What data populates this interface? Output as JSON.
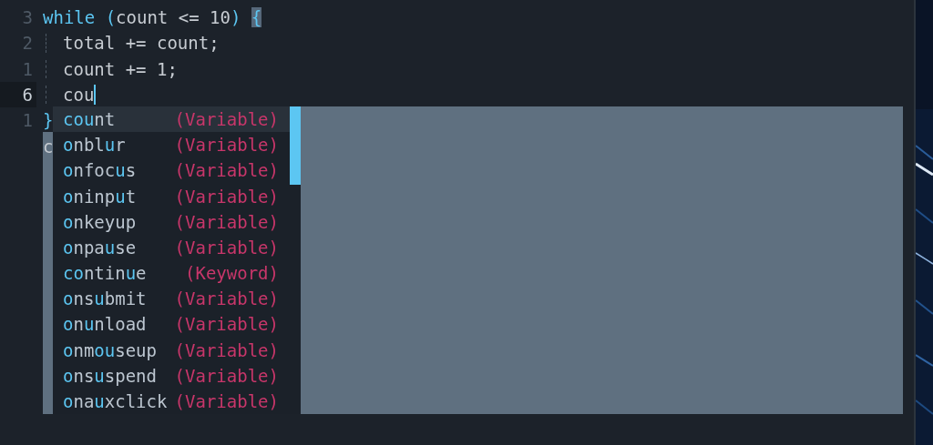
{
  "editor": {
    "lines": [
      {
        "number": "3",
        "current": false,
        "indented": false,
        "cursor": false,
        "tokens": [
          {
            "text": "while",
            "kind": "keyword"
          },
          {
            "text": " (",
            "kind": "punct"
          },
          {
            "text": "count <= 10",
            "kind": "plain"
          },
          {
            "text": ") ",
            "kind": "punct"
          },
          {
            "text": "{",
            "kind": "match"
          }
        ]
      },
      {
        "number": "2",
        "current": false,
        "indented": true,
        "cursor": false,
        "tokens": [
          {
            "text": "total += count;",
            "kind": "plain"
          }
        ]
      },
      {
        "number": "1",
        "current": false,
        "indented": true,
        "cursor": false,
        "tokens": [
          {
            "text": "count += 1;",
            "kind": "plain"
          }
        ]
      },
      {
        "number": "6",
        "current": true,
        "indented": true,
        "cursor": true,
        "tokens": [
          {
            "text": "cou",
            "kind": "plain"
          }
        ]
      },
      {
        "number": "1",
        "current": false,
        "indented": false,
        "cursor": false,
        "tokens": [
          {
            "text": "}",
            "kind": "punct"
          }
        ]
      },
      {
        "current": false,
        "indented": false,
        "cursor": false,
        "tokens": [
          {
            "text": "c",
            "kind": "plain"
          }
        ]
      }
    ]
  },
  "completion": {
    "items": [
      {
        "label": "**cou**nt",
        "kind_label": "(Variable)",
        "selected": true
      },
      {
        "label": "**o**nbl**u**r",
        "kind_label": "(Variable)",
        "selected": false
      },
      {
        "label": "**o**nfoc**u**s",
        "kind_label": "(Variable)",
        "selected": false
      },
      {
        "label": "**o**ninp**u**t",
        "kind_label": "(Variable)",
        "selected": false
      },
      {
        "label": "**o**nkeyup",
        "kind_label": "(Variable)",
        "selected": false
      },
      {
        "label": "**o**npa**u**se",
        "kind_label": "(Variable)",
        "selected": false
      },
      {
        "label": "**co**ntin**u**e",
        "kind_label": "(Keyword)",
        "selected": false
      },
      {
        "label": "**o**ns**u**bmit",
        "kind_label": "(Variable)",
        "selected": false
      },
      {
        "label": "**o**n**u**nload",
        "kind_label": "(Variable)",
        "selected": false
      },
      {
        "label": "**o**nm**ou**seup",
        "kind_label": "(Variable)",
        "selected": false
      },
      {
        "label": "**o**ns**u**spend",
        "kind_label": "(Variable)",
        "selected": false
      },
      {
        "label": "**o**na**u**xclick",
        "kind_label": "(Variable)",
        "selected": false
      }
    ]
  }
}
